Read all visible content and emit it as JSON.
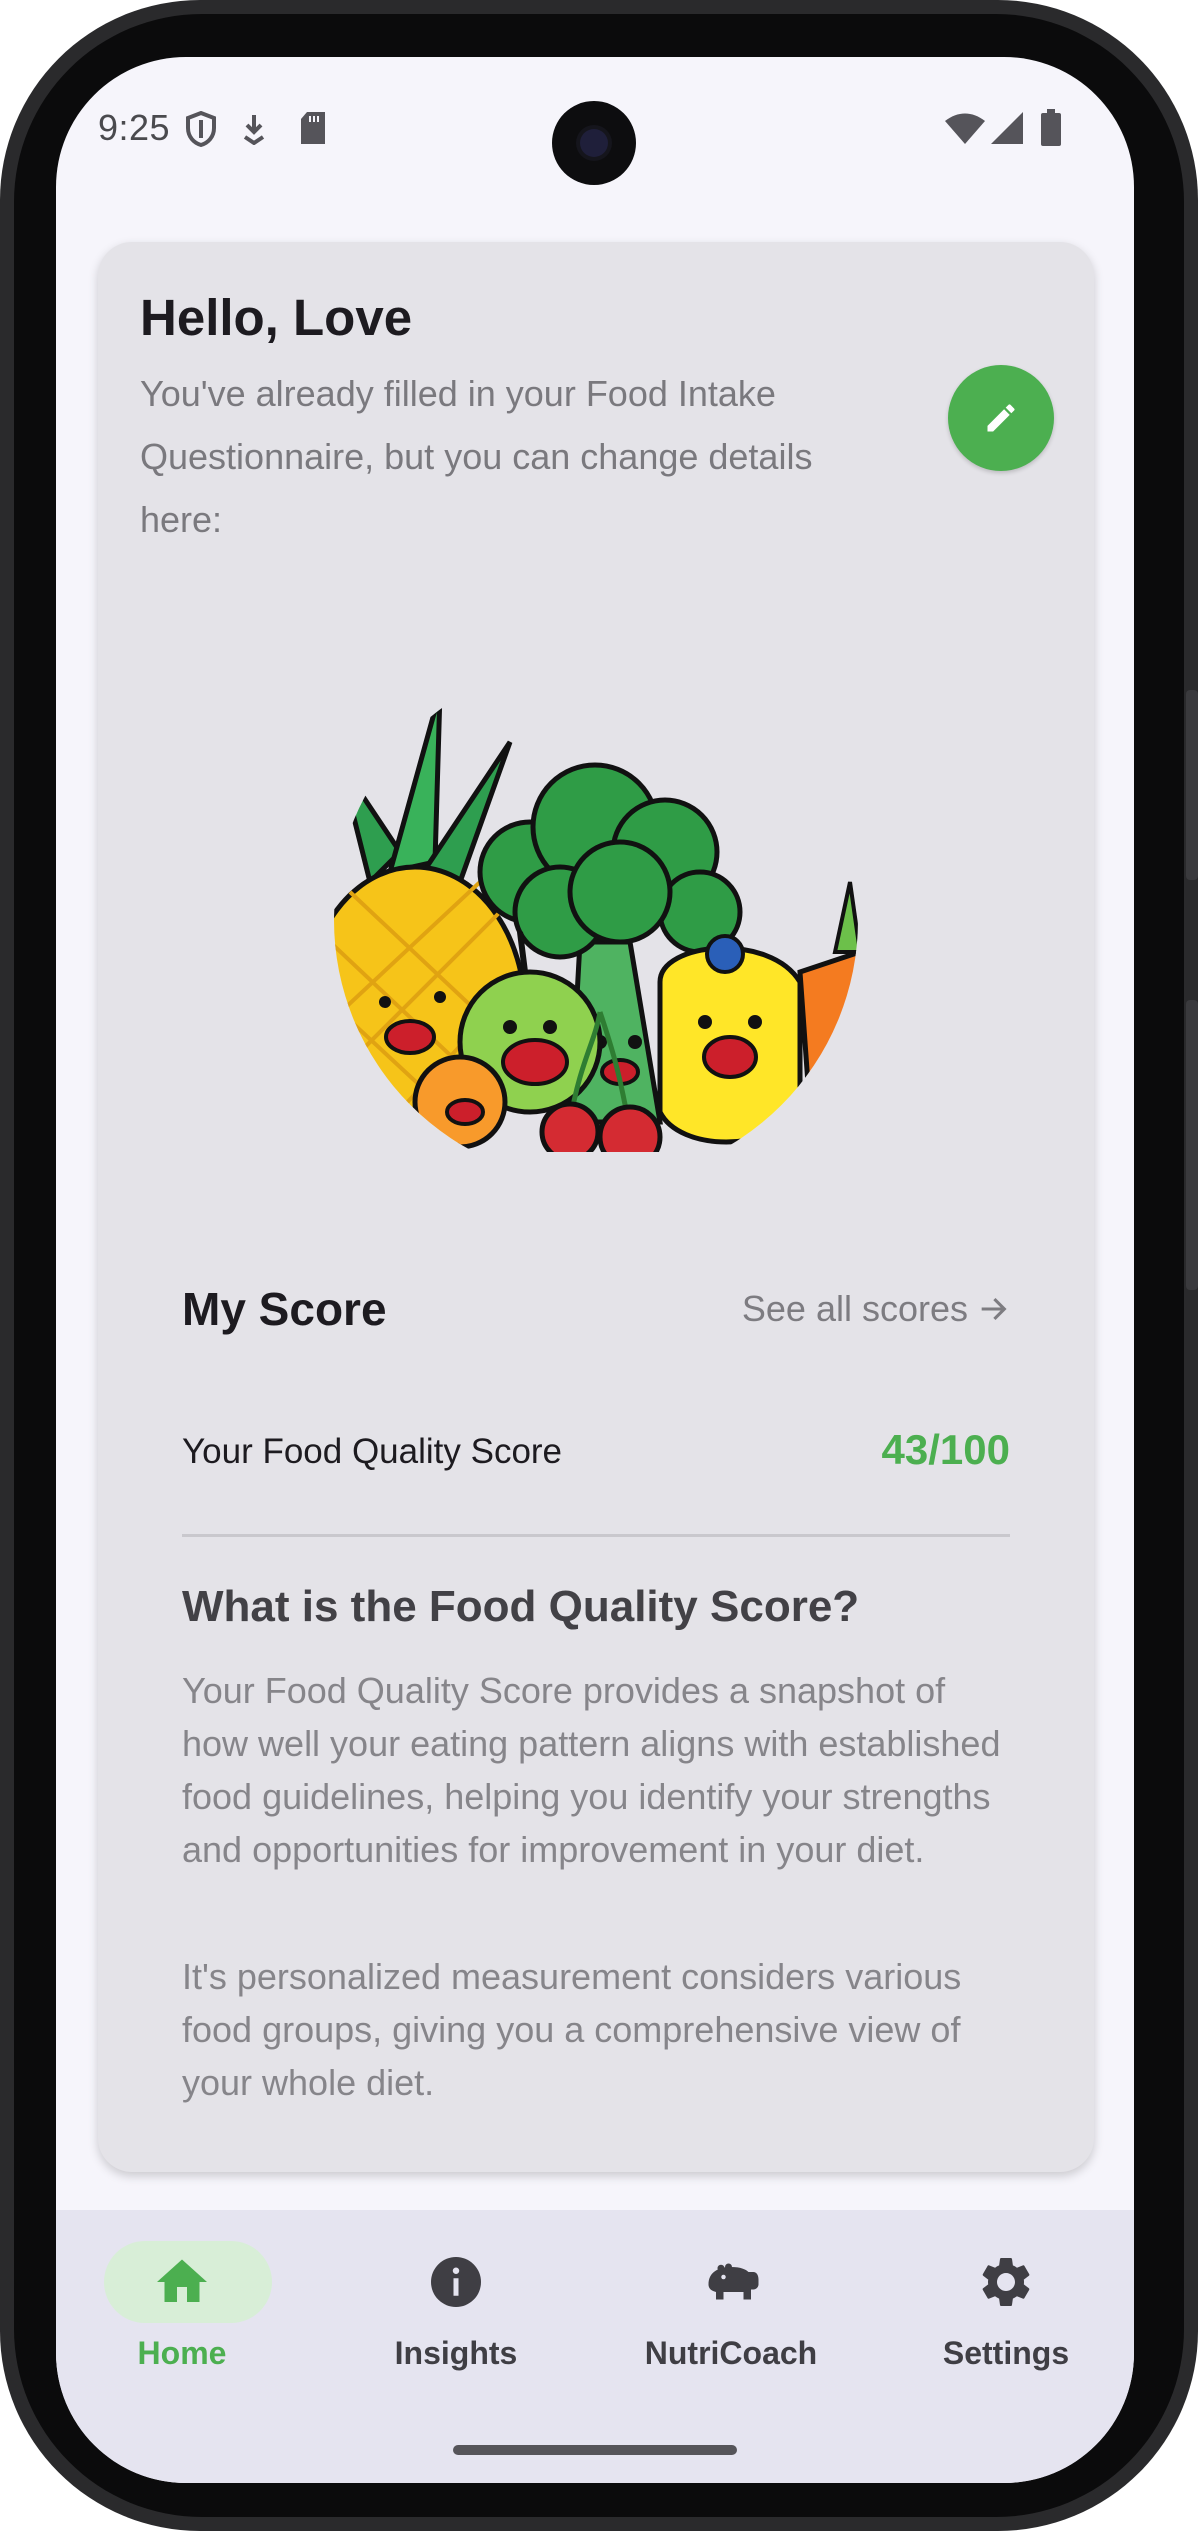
{
  "status_bar": {
    "time": "9:25"
  },
  "header": {
    "greeting": "Hello, Love",
    "intro": "You've already filled in your Food Intake Questionnaire, but you can change details here:"
  },
  "score": {
    "title": "My Score",
    "see_all": "See all scores",
    "food_quality_label": "Your Food Quality Score",
    "food_quality_value": "43/100"
  },
  "about": {
    "title": "What is the Food Quality Score?",
    "paragraph1": "Your Food Quality Score provides a snapshot of how well your eating pattern aligns with established food guidelines, helping you identify your strengths and opportunities for improvement in your diet.",
    "paragraph2": "It's personalized measurement considers various food groups, giving you a comprehensive view of your whole diet."
  },
  "bottom_nav": {
    "items": [
      {
        "label": "Home",
        "icon": "home-icon",
        "active": true
      },
      {
        "label": "Insights",
        "icon": "info-icon",
        "active": false
      },
      {
        "label": "NutriCoach",
        "icon": "hippo-icon",
        "active": false
      },
      {
        "label": "Settings",
        "icon": "gear-icon",
        "active": false
      }
    ]
  },
  "colors": {
    "accent": "#4caf50",
    "card_bg": "#e4e3e8",
    "nav_bg": "#e5e4f0",
    "active_pill": "#d8eed7"
  }
}
